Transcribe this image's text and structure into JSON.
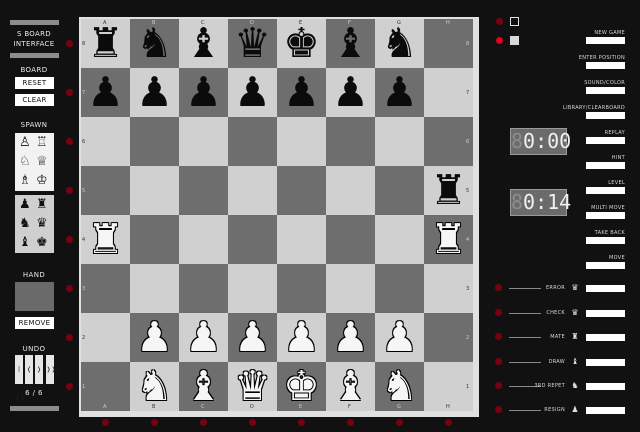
{
  "left": {
    "title_line1": "S BOARD",
    "title_line2": "INTERFACE",
    "board_label": "BOARD",
    "reset_label": "RESET",
    "clear_label": "CLEAR",
    "spawn_label": "SPAWN",
    "spawn_white": [
      "♙",
      "♖",
      "♘",
      "♕",
      "♗",
      "♔"
    ],
    "spawn_black": [
      "♟",
      "♜",
      "♞",
      "♛",
      "♝",
      "♚"
    ],
    "hand_label": "HAND",
    "remove_label": "REMOVE",
    "undo_label": "UNDO",
    "undo_buttons": [
      "|❬❬",
      "❬",
      "❭",
      "❭❭|"
    ],
    "undo_counter": "6 / 6"
  },
  "board": {
    "files": [
      "A",
      "B",
      "C",
      "D",
      "E",
      "F",
      "G",
      "H"
    ],
    "ranks": [
      "8",
      "7",
      "6",
      "5",
      "4",
      "3",
      "2",
      "1"
    ],
    "rows": [
      [
        "br",
        "bn",
        "bb",
        "bq",
        "bk",
        "bb",
        "bn",
        ""
      ],
      [
        "bp",
        "bp",
        "bp",
        "bp",
        "bp",
        "bp",
        "bp",
        ""
      ],
      [
        "",
        "",
        "",
        "",
        "",
        "",
        "",
        ""
      ],
      [
        "",
        "",
        "",
        "",
        "",
        "",
        "",
        "br"
      ],
      [
        "wr",
        "",
        "",
        "",
        "",
        "",
        "",
        "wr"
      ],
      [
        "",
        "",
        "",
        "",
        "",
        "",
        "",
        ""
      ],
      [
        "",
        "wp",
        "wp",
        "wp",
        "wp",
        "wp",
        "wp",
        ""
      ],
      [
        "",
        "wn",
        "wb",
        "wq",
        "wk",
        "wb",
        "wn",
        ""
      ]
    ],
    "glyphs": {
      "k": "♚",
      "q": "♛",
      "r": "♜",
      "b": "♝",
      "n": "♞",
      "p": "♟"
    }
  },
  "right": {
    "turn_indicator_color": "#e0001a",
    "controls": [
      {
        "label": "NEW GAME"
      },
      {
        "label": "ENTER POSITION"
      },
      {
        "label": "SOUND/COLOR"
      },
      {
        "label": "LIBRARY/CLEARBOARD"
      },
      {
        "label": "REPLAY"
      },
      {
        "label": "HINT"
      },
      {
        "label": "LEVEL"
      },
      {
        "label": "MULTI MOVE"
      },
      {
        "label": "TAKE BACK"
      },
      {
        "label": "MOVE"
      }
    ],
    "clock_white": "0:00",
    "clock_black": "0:14",
    "clock_ghost": "8",
    "events": [
      {
        "label": "ERROR",
        "icon": "♛"
      },
      {
        "label": "CHECK",
        "icon": "♛"
      },
      {
        "label": "MATE",
        "icon": "♜"
      },
      {
        "label": "DRAW",
        "icon": "♝"
      },
      {
        "label": "3RD REPET",
        "icon": "♞"
      },
      {
        "label": "RESIGN",
        "icon": "♟"
      }
    ]
  },
  "colors": {
    "background": "#111111",
    "light_square": "#d0d0d0",
    "dark_square": "#6e6e6e",
    "led": "#7a0010",
    "led_active": "#e0001a"
  }
}
